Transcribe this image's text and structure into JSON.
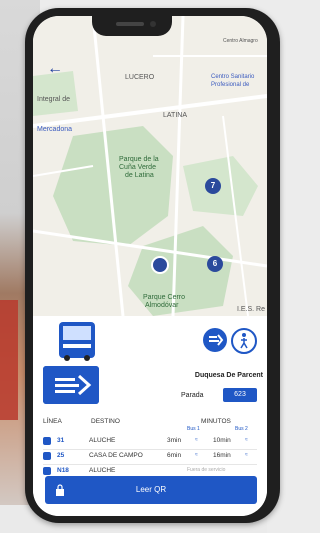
{
  "map": {
    "labels": {
      "lucero": "LUCERO",
      "latina": "LATINA",
      "centro": "Centro Sanitario",
      "centro2": "Profesional de",
      "integral": "Integral de",
      "mercadona": "Mercadona",
      "parque": "Parque de la",
      "parque2": "Cuña Verde",
      "parque3": "de Latina",
      "es": "I.E.S. Re",
      "cerro": "Parque Cerro",
      "cerro2": "Almodóvar",
      "top": "Centro Almagro"
    },
    "pins": {
      "p7": "7",
      "p6": "6"
    },
    "colors": {
      "park": "#c9dfc2",
      "road": "#ffffff",
      "accent": "#2b4a9c"
    }
  },
  "stop": {
    "name": "Duquesa De Parcent",
    "parada_label": "Parada",
    "parada_code": "623"
  },
  "table": {
    "headers": {
      "linea": "LÍNEA",
      "destino": "DESTINO",
      "minutos": "MINUTOS"
    },
    "sub": {
      "bus1": "Bus 1",
      "bus2": "Bus 2"
    },
    "rows": [
      {
        "line": "31",
        "dest": "ALUCHE",
        "t1": "3min",
        "t2": "10min"
      },
      {
        "line": "25",
        "dest": "CASA DE CAMPO",
        "t1": "6min",
        "t2": "16min"
      },
      {
        "line": "N18",
        "dest": "ALUCHE",
        "none": "Fuera de servicio"
      }
    ]
  },
  "qr": {
    "label": "Leer QR"
  },
  "colors": {
    "brand_blue": "#1f57c5"
  }
}
